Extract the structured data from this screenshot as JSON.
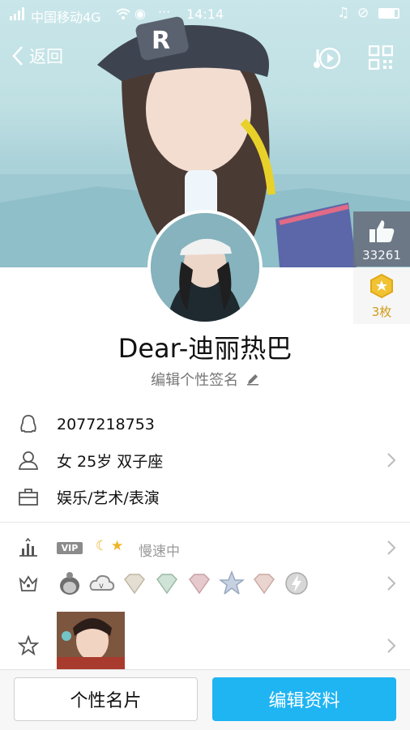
{
  "status_bar": {
    "carrier": "中国移动4G",
    "time": "14:14"
  },
  "nav": {
    "back_label": "返回"
  },
  "stats": {
    "likes": "33261",
    "coins": "3枚"
  },
  "profile": {
    "name": "Dear-迪丽热巴",
    "signature_placeholder": "编辑个性签名"
  },
  "info": {
    "qq": "2077218753",
    "basic": "女  25岁  双子座",
    "occupation": "娱乐/艺术/表演"
  },
  "level": {
    "vip_badge": "VIP",
    "speed_text": "慢速中"
  },
  "bottom": {
    "card_label": "个性名片",
    "edit_label": "编辑资料"
  },
  "colors": {
    "accent": "#1fb4f2",
    "coin": "#f1c232"
  }
}
